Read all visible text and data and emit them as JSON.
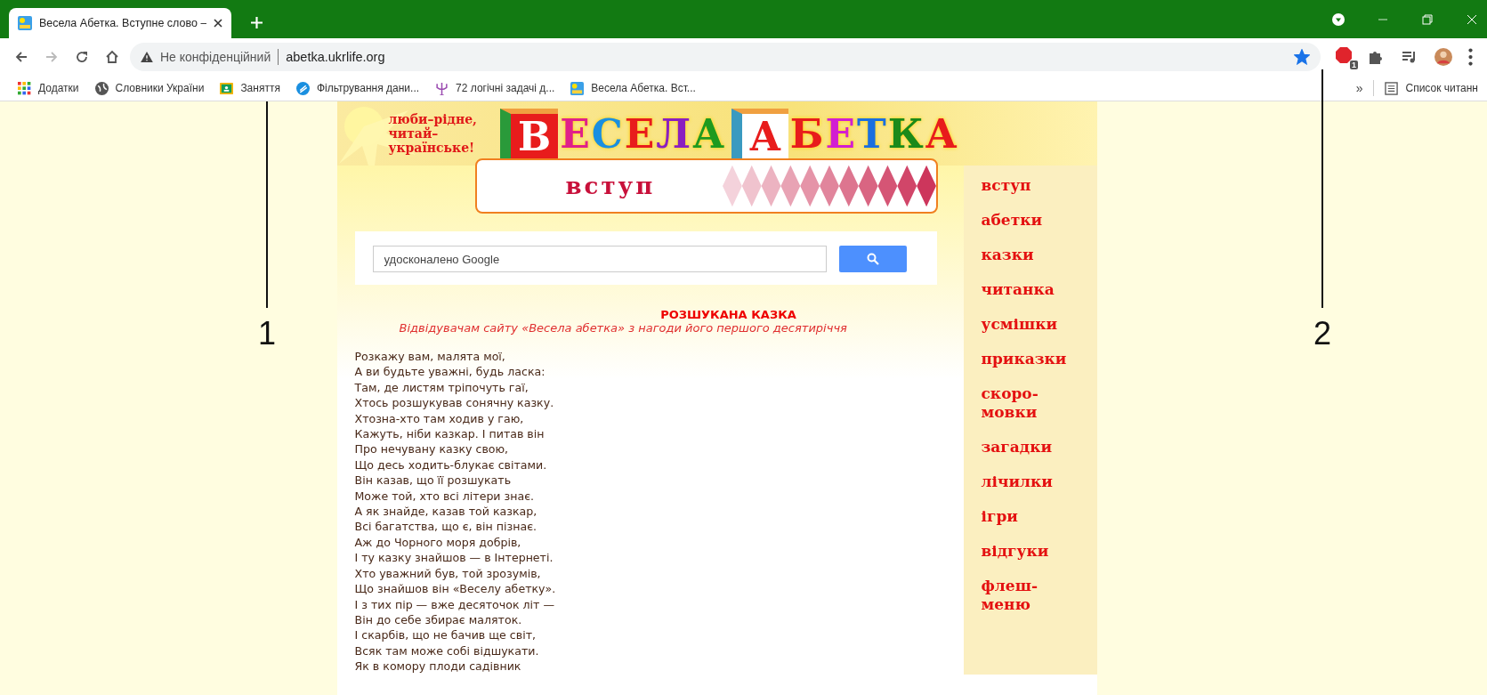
{
  "browser": {
    "tab": {
      "title": "Весела Абетка. Вступне слово –",
      "selected": true
    },
    "address": {
      "security": "Не конфіденційний",
      "url": "abetka.ukrlife.org",
      "bookmarked": true
    },
    "extension_badge": "1",
    "bookmarks": [
      {
        "label": "Додатки"
      },
      {
        "label": "Словники України"
      },
      {
        "label": "Заняття"
      },
      {
        "label": "Фільтрування дани..."
      },
      {
        "label": "72 логічні задачі д..."
      },
      {
        "label": "Весела Абетка. Вст..."
      }
    ],
    "more_bookmarks": "»",
    "reading_list": "Список читанн"
  },
  "page": {
    "slogan": [
      "люби–рідне,",
      "читай–",
      "українське!"
    ],
    "logo": [
      {
        "block": "В",
        "letters": [
          {
            "char": "Е",
            "color": "#e0208a"
          },
          {
            "char": "С",
            "color": "#1a8fe0"
          },
          {
            "char": "Е",
            "color": "#e81c1c"
          },
          {
            "char": "Л",
            "color": "#8a1fc0"
          },
          {
            "char": "А",
            "color": "#1f9a1f"
          }
        ]
      },
      {
        "block": "А",
        "letters": [
          {
            "char": "Б",
            "color": "#e81c1c"
          },
          {
            "char": "Е",
            "color": "#d21fd2"
          },
          {
            "char": "Т",
            "color": "#1a6fe0"
          },
          {
            "char": "К",
            "color": "#1a8a1a"
          },
          {
            "char": "А",
            "color": "#e81c1c"
          }
        ]
      }
    ],
    "section_title": "вступ",
    "search": {
      "placeholder": "удосконалено Google"
    },
    "poem": {
      "title": "РОЗШУКАНА КАЗКА",
      "dedication": "Відвідувачам сайту «Весела абетка» з нагоди його першого десятиріччя",
      "lines": [
        "Розкажу вам, малята мої,",
        "А ви будьте уважні, будь ласка:",
        "Там, де листям тріпочуть гаї,",
        "Хтось розшукував сонячну казку.",
        "Хтозна-хто там ходив у гаю,",
        "Кажуть, ніби казкар. І питав він",
        "Про нечувану казку свою,",
        "Що десь ходить-блукає світами.",
        "Він казав, що її розшукать",
        "Може той, хто всі літери знає.",
        "А як знайде, казав той казкар,",
        "Всі багатства, що є, він пізнає.",
        "Аж до Чорного моря добрів,",
        "І ту казку знайшов — в Інтернеті.",
        "Хто уважний був, той зрозумів,",
        "Що знайшов він «Веселу абетку».",
        "І з тих пір — вже десяточок літ —",
        "Він до себе збирає маляток.",
        "І скарбів, що не бачив ще світ,",
        "Всяк там може собі відшукати.",
        "Як в комору плоди садівник"
      ]
    },
    "nav": [
      [
        "вступ"
      ],
      [
        "абетки"
      ],
      [
        "казки"
      ],
      [
        "читанка"
      ],
      [
        "усмішки"
      ],
      [
        "приказки"
      ],
      [
        "скоро-",
        "мовки"
      ],
      [
        "загадки"
      ],
      [
        "лічилки"
      ],
      [
        "ігри"
      ],
      [
        "відгуки"
      ],
      [
        "флеш-",
        "меню"
      ]
    ]
  },
  "annotations": [
    {
      "number": "1"
    },
    {
      "number": "2"
    }
  ]
}
